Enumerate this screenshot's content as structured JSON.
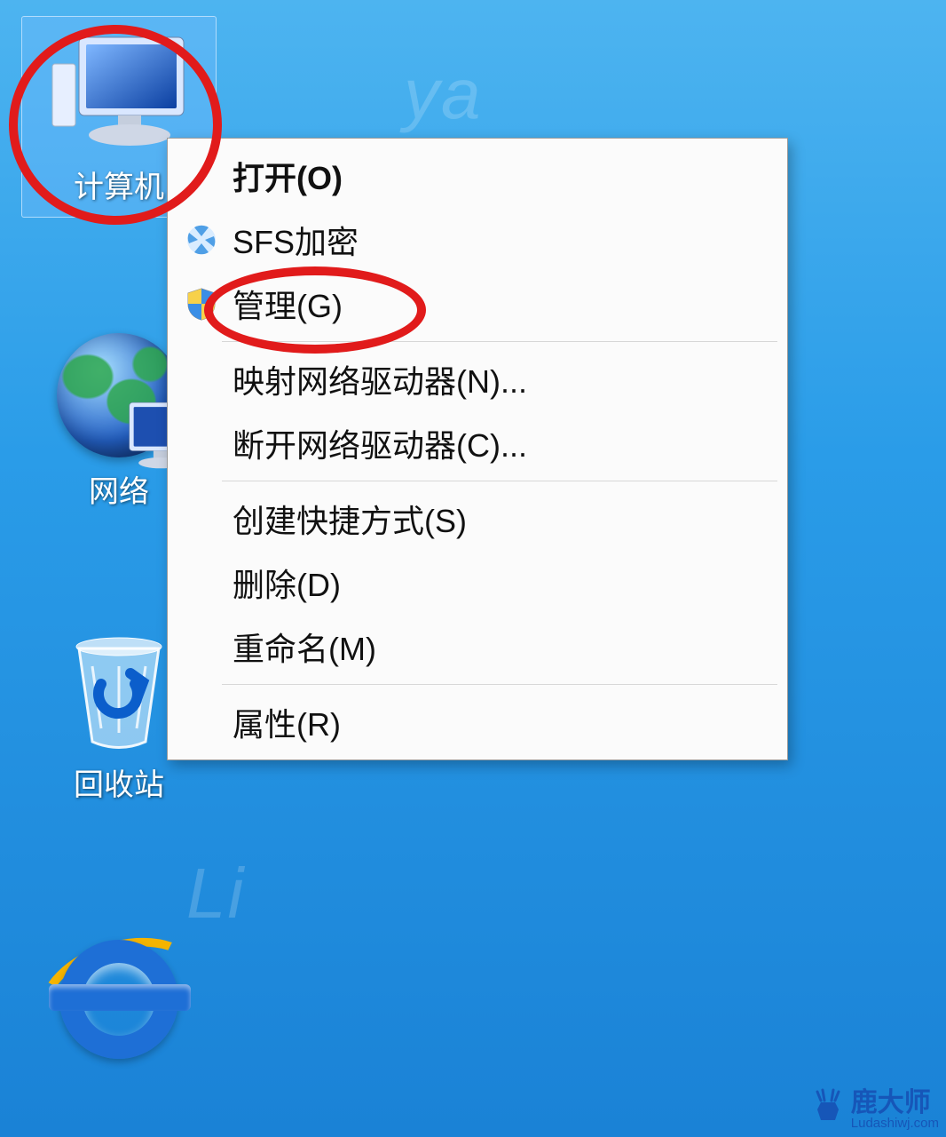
{
  "desktop_icons": {
    "computer": {
      "label": "计算机"
    },
    "network": {
      "label": "网络"
    },
    "recycle": {
      "label": "回收站"
    }
  },
  "context_menu": {
    "open": {
      "label": "打开(O)"
    },
    "sfs_encrypt": {
      "label": "SFS加密"
    },
    "manage": {
      "label": "管理(G)"
    },
    "map_drive": {
      "label": "映射网络驱动器(N)..."
    },
    "disconnect_drive": {
      "label": "断开网络驱动器(C)..."
    },
    "create_shortcut": {
      "label": "创建快捷方式(S)"
    },
    "delete": {
      "label": "删除(D)"
    },
    "rename": {
      "label": "重命名(M)"
    },
    "properties": {
      "label": "属性(R)"
    }
  },
  "watermark": {
    "brand_cn": "鹿大师",
    "url": "Ludashiwj.com"
  }
}
